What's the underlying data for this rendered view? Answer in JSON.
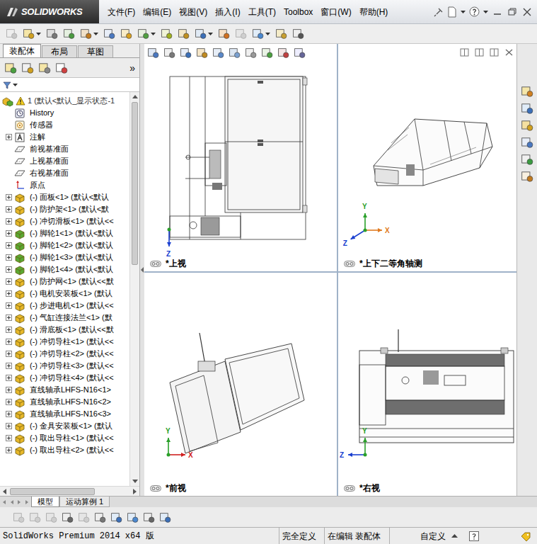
{
  "app": {
    "logo": "SOLIDWORKS",
    "menu": [
      "文件(F)",
      "编辑(E)",
      "视图(V)",
      "插入(I)",
      "工具(T)",
      "Toolbox",
      "窗口(W)",
      "帮助(H)"
    ]
  },
  "panel": {
    "tabs": [
      {
        "label": "装配体",
        "selected": true
      },
      {
        "label": "布局",
        "selected": false
      },
      {
        "label": "草图",
        "selected": false
      }
    ],
    "more": "»"
  },
  "tree": {
    "root": {
      "label": "1  (默认<默认_显示状态-1",
      "warning": true
    },
    "items": [
      {
        "label": "History",
        "kind": "history",
        "expandable": false,
        "expanded": false
      },
      {
        "label": "传感器",
        "kind": "sensor",
        "expandable": false,
        "expanded": false
      },
      {
        "label": "注解",
        "kind": "annotation",
        "expandable": true,
        "expanded": false
      },
      {
        "label": "前视基准面",
        "kind": "plane",
        "expandable": false,
        "expanded": false
      },
      {
        "label": "上视基准面",
        "kind": "plane",
        "expandable": false,
        "expanded": false
      },
      {
        "label": "右视基准面",
        "kind": "plane",
        "expandable": false,
        "expanded": false
      },
      {
        "label": "原点",
        "kind": "origin",
        "expandable": false,
        "expanded": false
      },
      {
        "label": "(-) 面板<1> (默认<默认",
        "kind": "part",
        "expandable": true,
        "expanded": false,
        "color": "#e8b82a"
      },
      {
        "label": "(-) 防护架<1> (默认<默",
        "kind": "part",
        "expandable": true,
        "expanded": false,
        "color": "#e8b82a"
      },
      {
        "label": "(-) 冲切滑板<1> (默认<<",
        "kind": "part",
        "expandable": true,
        "expanded": false,
        "color": "#e8b82a"
      },
      {
        "label": "(-) 脚轮1<1> (默认<默认",
        "kind": "part",
        "expandable": true,
        "expanded": false,
        "color": "#5aa832"
      },
      {
        "label": "(-) 脚轮1<2> (默认<默认",
        "kind": "part",
        "expandable": true,
        "expanded": false,
        "color": "#5aa832"
      },
      {
        "label": "(-) 脚轮1<3> (默认<默认",
        "kind": "part",
        "expandable": true,
        "expanded": false,
        "color": "#5aa832"
      },
      {
        "label": "(-) 脚轮1<4> (默认<默认",
        "kind": "part",
        "expandable": true,
        "expanded": false,
        "color": "#5aa832"
      },
      {
        "label": "(-) 防护网<1> (默认<<默",
        "kind": "part",
        "expandable": true,
        "expanded": false,
        "color": "#e8b82a"
      },
      {
        "label": "(-) 电机安装板<1> (默认",
        "kind": "part",
        "expandable": true,
        "expanded": false,
        "color": "#e8b82a"
      },
      {
        "label": "(-) 步进电机<1> (默认<<",
        "kind": "part",
        "expandable": true,
        "expanded": false,
        "color": "#e8b82a"
      },
      {
        "label": "(-) 气缸连接法兰<1> (默",
        "kind": "part",
        "expandable": true,
        "expanded": false,
        "color": "#e8b82a"
      },
      {
        "label": "(-) 滑底板<1> (默认<<默",
        "kind": "part",
        "expandable": true,
        "expanded": false,
        "color": "#e8b82a"
      },
      {
        "label": "(-) 冲切导柱<1> (默认<<",
        "kind": "part",
        "expandable": true,
        "expanded": false,
        "color": "#e8b82a"
      },
      {
        "label": "(-) 冲切导柱<2> (默认<<",
        "kind": "part",
        "expandable": true,
        "expanded": false,
        "color": "#e8b82a"
      },
      {
        "label": "(-) 冲切导柱<3> (默认<<",
        "kind": "part",
        "expandable": true,
        "expanded": false,
        "color": "#e8b82a"
      },
      {
        "label": "(-) 冲切导柱<4> (默认<<",
        "kind": "part",
        "expandable": true,
        "expanded": false,
        "color": "#e8b82a"
      },
      {
        "label": "直线轴承LHFS-N16<1>",
        "kind": "part",
        "expandable": true,
        "expanded": false,
        "color": "#e8b82a"
      },
      {
        "label": "直线轴承LHFS-N16<2>",
        "kind": "part",
        "expandable": true,
        "expanded": false,
        "color": "#e8b82a"
      },
      {
        "label": "直线轴承LHFS-N16<3>",
        "kind": "part",
        "expandable": true,
        "expanded": false,
        "color": "#e8b82a"
      },
      {
        "label": "(-) 金具安装板<1> (默认",
        "kind": "part",
        "expandable": true,
        "expanded": false,
        "color": "#e8b82a"
      },
      {
        "label": "(-) 取出导柱<1> (默认<<",
        "kind": "part",
        "expandable": true,
        "expanded": false,
        "color": "#e8b82a"
      },
      {
        "label": "(-) 取出导柱<2> (默认<<",
        "kind": "part",
        "expandable": true,
        "expanded": false,
        "color": "#e8b82a"
      }
    ]
  },
  "bottom_tabs": [
    {
      "label": "模型",
      "selected": true
    },
    {
      "label": "运动算例 1",
      "selected": false
    }
  ],
  "views": [
    {
      "label": "*上视",
      "kind": "top",
      "axes": [
        {
          "name": "Z",
          "dir": "down",
          "color": "#1a3fd0"
        }
      ]
    },
    {
      "label": "*上下二等角轴测",
      "kind": "iso",
      "axes": [
        {
          "name": "Y",
          "dir": "up",
          "color": "#2aa02a"
        },
        {
          "name": "X",
          "dir": "right",
          "color": "#e07a20"
        },
        {
          "name": "Z",
          "dir": "downleft",
          "color": "#1a3fd0"
        }
      ]
    },
    {
      "label": "*前视",
      "kind": "front",
      "axes": [
        {
          "name": "Y",
          "dir": "up",
          "color": "#2aa02a"
        },
        {
          "name": "X",
          "dir": "right",
          "color": "#d02020"
        }
      ]
    },
    {
      "label": "*右视",
      "kind": "right",
      "axes": [
        {
          "name": "Y",
          "dir": "up",
          "color": "#2aa02a"
        },
        {
          "name": "Z",
          "dir": "left",
          "color": "#1a3fd0"
        }
      ]
    }
  ],
  "status_bar": {
    "version": "SolidWorks Premium 2014 x64 版",
    "state": "完全定义",
    "mode": "在编辑 装配体",
    "units": "自定义"
  }
}
